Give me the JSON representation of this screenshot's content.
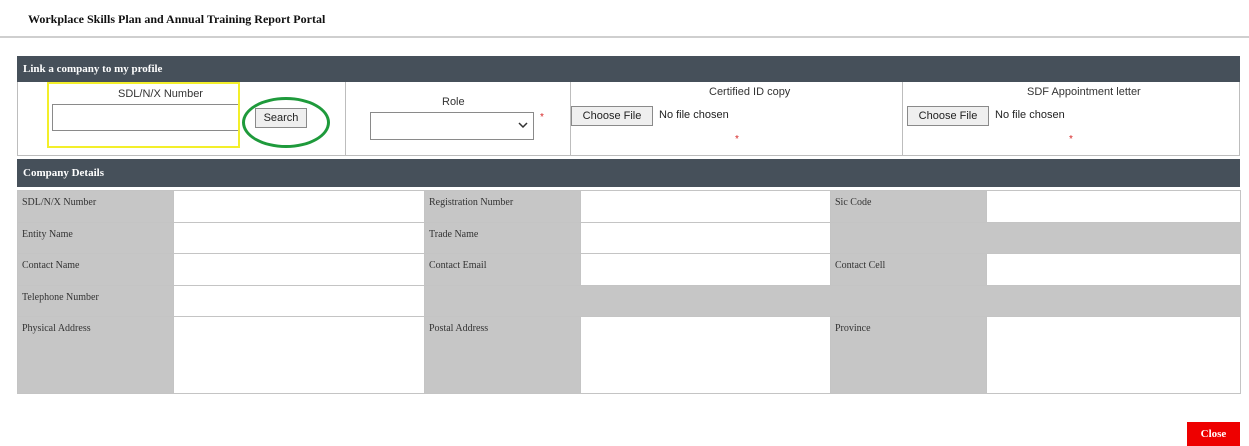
{
  "page": {
    "title": "Workplace Skills Plan and Annual Training Report Portal"
  },
  "link_section": {
    "header": "Link a company to my profile",
    "sdl_label": "SDL/N/X Number",
    "sdl_value": "",
    "search_label": "Search",
    "role_label": "Role",
    "role_value": "",
    "required_marker": "*",
    "certified_id_label": "Certified ID copy",
    "sdf_letter_label": "SDF Appointment letter",
    "choose_file_label": "Choose File",
    "no_file_text": "No file chosen"
  },
  "company_details": {
    "header": "Company Details",
    "labels": {
      "sdl_number": "SDL/N/X Number",
      "registration_number": "Registration Number",
      "sic_code": "Sic Code",
      "entity_name": "Entity Name",
      "trade_name": "Trade Name",
      "contact_name": "Contact Name",
      "contact_email": "Contact Email",
      "contact_cell": "Contact Cell",
      "telephone_number": "Telephone Number",
      "physical_address": "Physical Address",
      "postal_address": "Postal Address",
      "province": "Province"
    }
  },
  "footer": {
    "close_label": "Close"
  },
  "colors": {
    "header_bar": "#46505a",
    "label_cell": "#c6c6c6",
    "close_button": "#ee0000",
    "highlight_yellow": "#f3ef2a",
    "highlight_green": "#1e9a3b",
    "required": "#d62828"
  }
}
